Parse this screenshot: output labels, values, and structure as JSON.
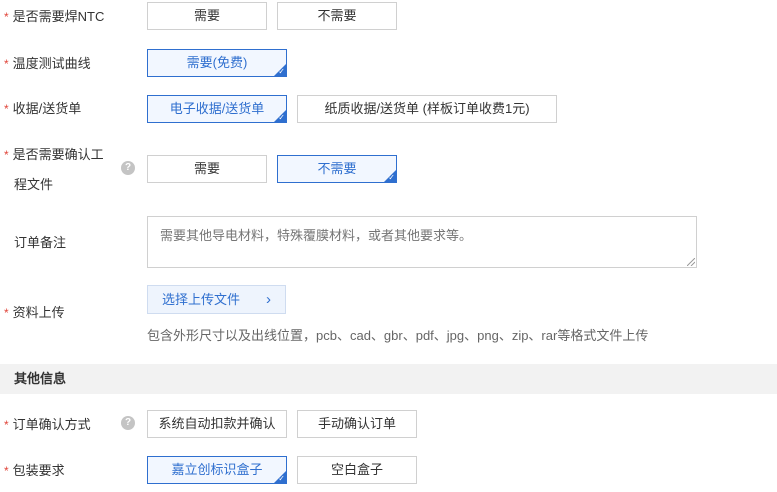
{
  "fields": {
    "ntc": {
      "label": "是否需要焊NTC",
      "options": [
        "需要",
        "不需要"
      ]
    },
    "temp_curve": {
      "label": "温度测试曲线",
      "options": [
        "需要(免费)"
      ]
    },
    "receipt": {
      "label": "收据/送货单",
      "options": [
        "电子收据/送货单",
        "纸质收据/送货单 (样板订单收费1元)"
      ]
    },
    "confirm_eng": {
      "label_line1": "是否需要确认工",
      "label_line2": "程文件",
      "options": [
        "需要",
        "不需要"
      ]
    },
    "remark": {
      "label": "订单备注",
      "placeholder": "需要其他导电材料，特殊覆膜材料，或者其他要求等。"
    },
    "upload": {
      "label": "资料上传",
      "button_label": "选择上传文件",
      "hint": "包含外形尺寸以及出线位置，pcb、cad、gbr、pdf、jpg、png、zip、rar等格式文件上传"
    }
  },
  "other_section": {
    "title": "其他信息",
    "order_confirm": {
      "label": "订单确认方式",
      "options": [
        "系统自动扣款并确认",
        "手动确认订单"
      ]
    },
    "packaging": {
      "label": "包装要求",
      "options": [
        "嘉立创标识盒子",
        "空白盒子"
      ]
    }
  },
  "selected": {
    "ntc": null,
    "temp_curve": "需要(免费)",
    "receipt": "电子收据/送货单",
    "confirm_eng": "不需要",
    "order_confirm": null,
    "packaging": "嘉立创标识盒子"
  },
  "icons": {
    "help": "question-circle-icon",
    "selected_corner": "check-corner-icon",
    "upload_arrow": "chevron-right-icon"
  },
  "colors": {
    "accent": "#2f6fcf",
    "required": "#e0453a",
    "section_bg": "#f2f2f2"
  }
}
